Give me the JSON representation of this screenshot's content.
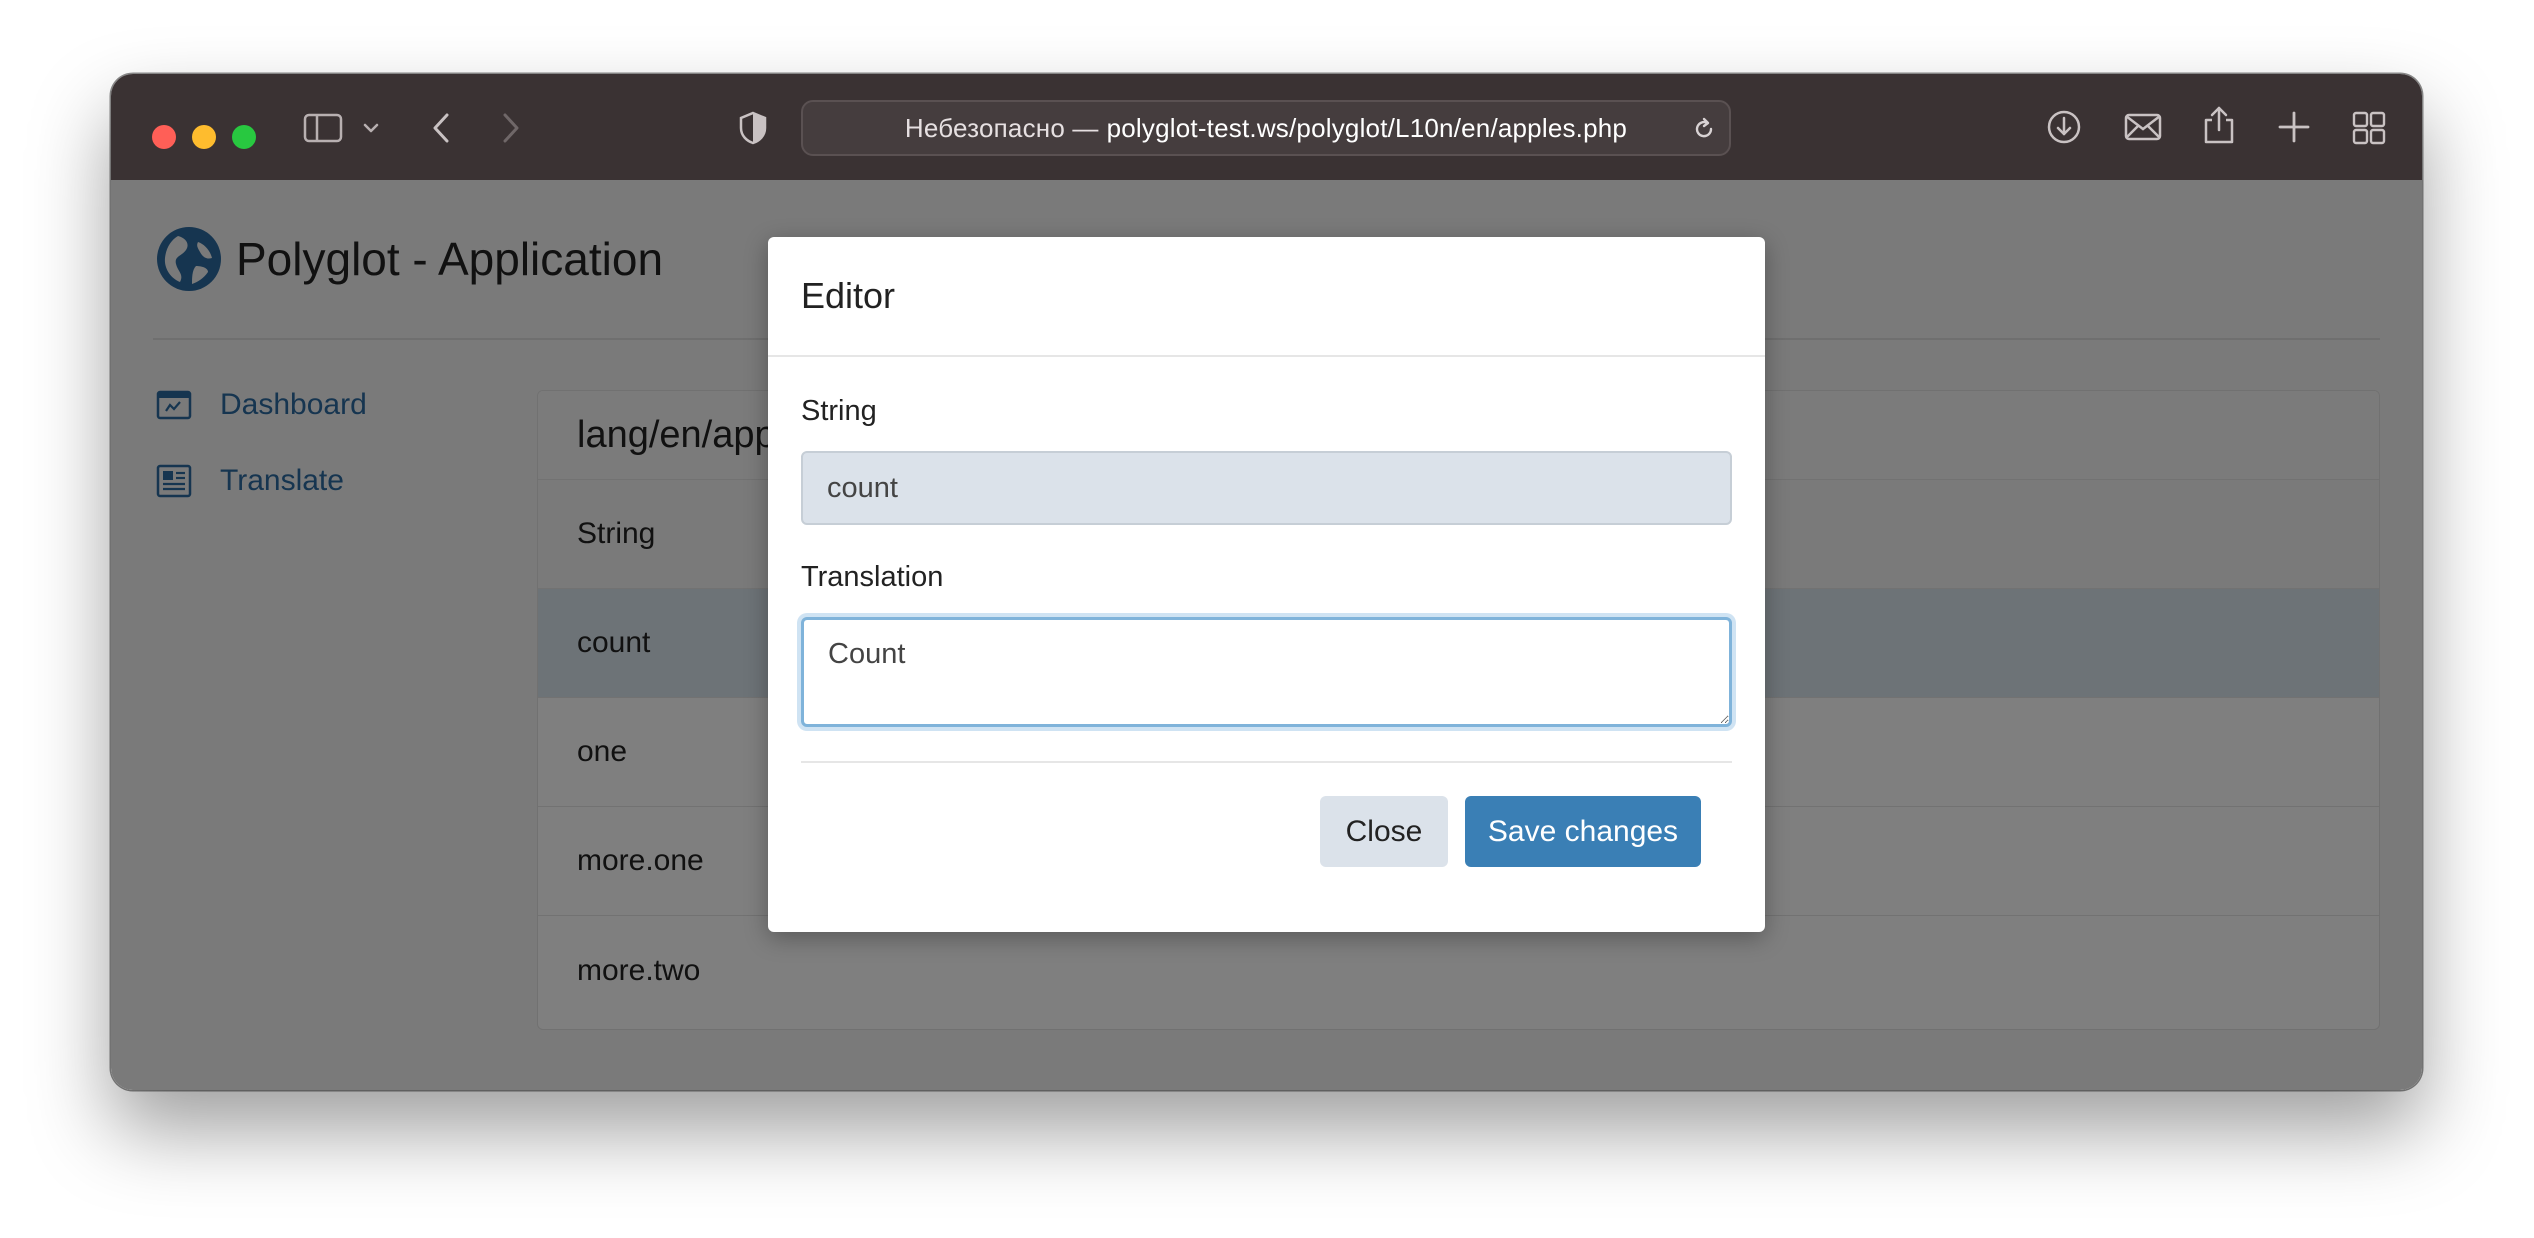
{
  "browser": {
    "url_prefix": "Небезопасно —",
    "url_host": "polyglot-test.ws/polyglot/L10n/en/apples.php"
  },
  "app": {
    "title": "Polyglot - Application",
    "nav": [
      {
        "label": "Dashboard",
        "icon": "dashboard-icon"
      },
      {
        "label": "Translate",
        "icon": "document-icon"
      }
    ]
  },
  "panel": {
    "title": "lang/en/apples.php",
    "column_header": "String",
    "rows": [
      "count",
      "one",
      "more.one",
      "more.two"
    ],
    "selected_row": "count"
  },
  "modal": {
    "title": "Editor",
    "string_label": "String",
    "string_value": "count",
    "translation_label": "Translation",
    "translation_value": "Count",
    "close_label": "Close",
    "save_label": "Save changes"
  },
  "colors": {
    "accent": "#3a7fb5",
    "link": "#2c6aa0",
    "titlebar": "#3a3233"
  }
}
